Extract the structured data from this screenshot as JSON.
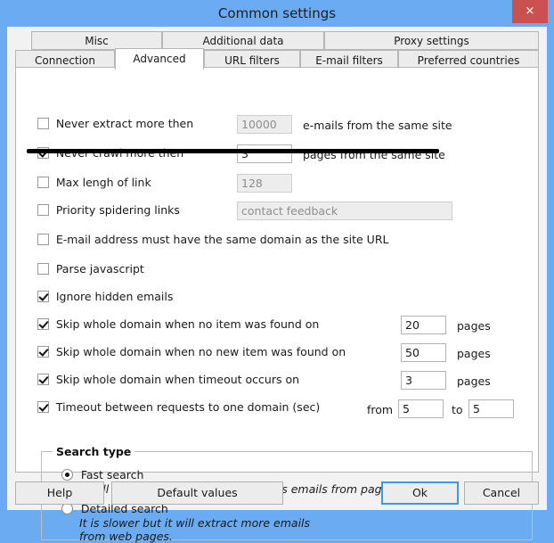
{
  "window": {
    "title": "Common settings",
    "close_label": "×",
    "close_icon": "close-icon",
    "titlebar_color": "#6aabf2",
    "accent_color": "#3b9ae1",
    "close_button_color": "#c9514f"
  },
  "tabs": {
    "row1": [
      {
        "label": "Misc",
        "active": false
      },
      {
        "label": "Additional data",
        "active": false
      },
      {
        "label": "Proxy settings",
        "active": false
      }
    ],
    "row2": [
      {
        "label": "Connection",
        "active": false
      },
      {
        "label": "Advanced",
        "active": true
      },
      {
        "label": "URL filters",
        "active": false
      },
      {
        "label": "E-mail filters",
        "active": false
      },
      {
        "label": "Preferred countries",
        "active": false
      }
    ]
  },
  "advanced": {
    "never_extract": {
      "label": "Never extract more then",
      "checked": false,
      "value": "10000",
      "enabled": false,
      "suffix": "e-mails from the same site"
    },
    "never_crawl": {
      "label": "Never crawl more then",
      "checked": true,
      "value": "3",
      "enabled": true,
      "suffix": "pages from the same site"
    },
    "max_length_link": {
      "label": "Max lengh of link",
      "checked": false,
      "value": "128",
      "enabled": false,
      "suffix": ""
    },
    "priority_spidering": {
      "label": "Priority spidering links",
      "checked": false,
      "value": "contact feedback",
      "enabled": false,
      "suffix": ""
    },
    "same_domain": {
      "label": "E-mail address must have the same domain as the site URL",
      "checked": false
    },
    "parse_javascript": {
      "label": "Parse javascript",
      "checked": false
    },
    "ignore_hidden": {
      "label": "Ignore hidden emails",
      "checked": true
    },
    "skip_no_item": {
      "label": "Skip whole domain when no item was found on",
      "checked": true,
      "value": "20",
      "suffix": "pages"
    },
    "skip_no_new_item": {
      "label": "Skip whole domain when no new item was found on",
      "checked": true,
      "value": "50",
      "suffix": "pages"
    },
    "skip_timeout": {
      "label": "Skip whole domain when timeout occurs on",
      "checked": true,
      "value": "3",
      "suffix": "pages"
    },
    "timeout_between": {
      "label": "Timeout between requests to one domain (sec)",
      "checked": true,
      "from_label": "from",
      "from_value": "5",
      "to_label": "to",
      "to_value": "5"
    }
  },
  "search_type": {
    "title": "Search type",
    "options": [
      {
        "label": "Fast search",
        "description": "It will work faster but will extract less emails from pages.",
        "selected": true
      },
      {
        "label": "Detailed search",
        "description": "It is slower but it will extract more emails from web pages.",
        "selected": false
      }
    ]
  },
  "footer": {
    "help": "Help",
    "default_values": "Default values",
    "ok": "Ok",
    "cancel": "Cancel"
  }
}
